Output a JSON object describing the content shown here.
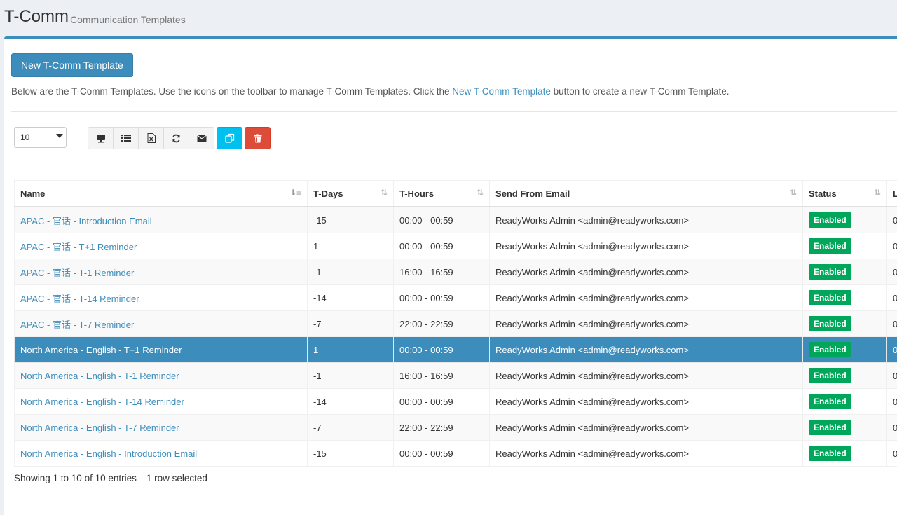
{
  "header": {
    "title": "T-Comm",
    "subtitle": "Communication Templates"
  },
  "new_button_label": "New T-Comm Template",
  "intro": {
    "before": "Below are the T-Comm Templates. Use the icons on the toolbar to manage T-Comm Templates. Click the ",
    "link": "New T-Comm Template",
    "after": " button to create a new T-Comm Template."
  },
  "page_size": {
    "selected": "10"
  },
  "toolbar": {
    "icons": [
      "monitor-icon",
      "list-icon",
      "excel-export-icon",
      "refresh-icon",
      "email-icon",
      "copy-icon",
      "trash-icon"
    ],
    "colors": {
      "copy": "#00c0ef",
      "delete": "#dd4b39",
      "accent": "#3c8dbc",
      "status_enabled": "#00a65a"
    }
  },
  "columns": [
    "Name",
    "T-Days",
    "T-Hours",
    "Send From Email",
    "Status",
    "L"
  ],
  "rows": [
    {
      "name": "APAC - 官话 - Introduction Email",
      "tdays": "-15",
      "thours": "00:00 - 00:59",
      "email": "ReadyWorks Admin <admin@readyworks.com>",
      "status": "Enabled",
      "last": "0"
    },
    {
      "name": "APAC - 官话 - T+1 Reminder",
      "tdays": "1",
      "thours": "00:00 - 00:59",
      "email": "ReadyWorks Admin <admin@readyworks.com>",
      "status": "Enabled",
      "last": "0"
    },
    {
      "name": "APAC - 官话 - T-1 Reminder",
      "tdays": "-1",
      "thours": "16:00 - 16:59",
      "email": "ReadyWorks Admin <admin@readyworks.com>",
      "status": "Enabled",
      "last": "0"
    },
    {
      "name": "APAC - 官话 - T-14 Reminder",
      "tdays": "-14",
      "thours": "00:00 - 00:59",
      "email": "ReadyWorks Admin <admin@readyworks.com>",
      "status": "Enabled",
      "last": "0"
    },
    {
      "name": "APAC - 官话 - T-7 Reminder",
      "tdays": "-7",
      "thours": "22:00 - 22:59",
      "email": "ReadyWorks Admin <admin@readyworks.com>",
      "status": "Enabled",
      "last": "0"
    },
    {
      "name": "North America - English - T+1 Reminder",
      "tdays": "1",
      "thours": "00:00 - 00:59",
      "email": "ReadyWorks Admin <admin@readyworks.com>",
      "status": "Enabled",
      "last": "0"
    },
    {
      "name": "North America - English - T-1 Reminder",
      "tdays": "-1",
      "thours": "16:00 - 16:59",
      "email": "ReadyWorks Admin <admin@readyworks.com>",
      "status": "Enabled",
      "last": "0"
    },
    {
      "name": "North America - English - T-14 Reminder",
      "tdays": "-14",
      "thours": "00:00 - 00:59",
      "email": "ReadyWorks Admin <admin@readyworks.com>",
      "status": "Enabled",
      "last": "0"
    },
    {
      "name": "North America - English - T-7 Reminder",
      "tdays": "-7",
      "thours": "22:00 - 22:59",
      "email": "ReadyWorks Admin <admin@readyworks.com>",
      "status": "Enabled",
      "last": "0"
    },
    {
      "name": "North America - English - Introduction Email",
      "tdays": "-15",
      "thours": "00:00 - 00:59",
      "email": "ReadyWorks Admin <admin@readyworks.com>",
      "status": "Enabled",
      "last": "0"
    }
  ],
  "selected_row_index": 5,
  "footer": {
    "showing": "Showing 1 to 10 of 10 entries",
    "selected": "1 row selected"
  }
}
